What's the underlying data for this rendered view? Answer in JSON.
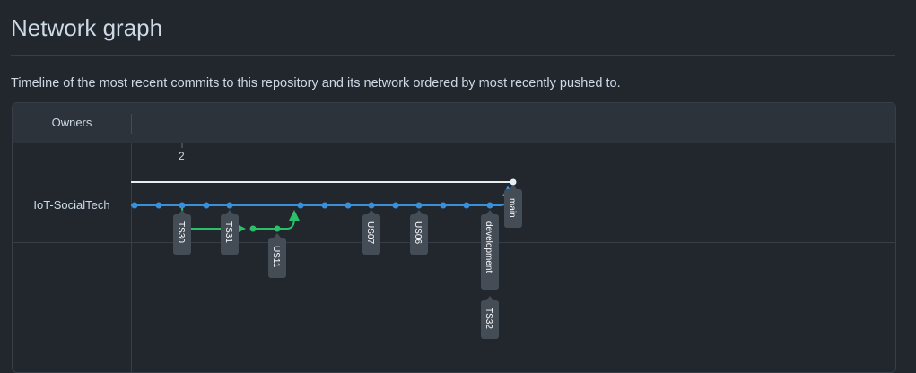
{
  "page": {
    "title": "Network graph",
    "description": "Timeline of the most recent commits to this repository and its network ordered by most recently pushed to."
  },
  "graph": {
    "owners_heading": "Owners",
    "owner": "IoT-SocialTech",
    "date_label": "2",
    "colors": {
      "main_line": "#e6edf3",
      "development_line": "#3a8fd9",
      "feature_line": "#2bc16a",
      "tag_bg": "#444c56"
    },
    "labels": {
      "main": "main",
      "TS30": "TS30",
      "TS31": "TS31",
      "US11": "US11",
      "US07": "US07",
      "US06": "US06",
      "development": "development",
      "TS32": "TS32"
    }
  }
}
